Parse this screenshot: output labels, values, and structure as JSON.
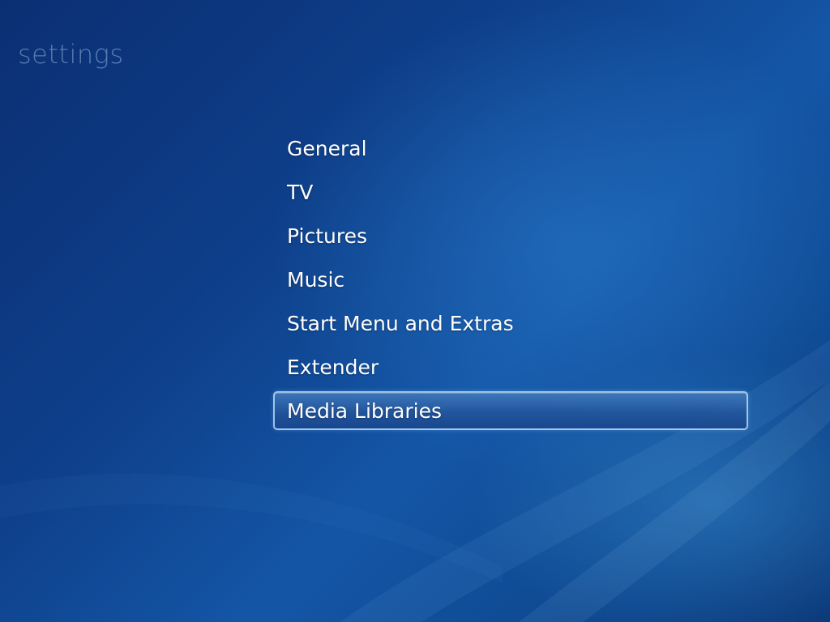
{
  "header": {
    "title": "settings"
  },
  "menu": {
    "items": [
      {
        "label": "General"
      },
      {
        "label": "TV"
      },
      {
        "label": "Pictures"
      },
      {
        "label": "Music"
      },
      {
        "label": "Start Menu and Extras"
      },
      {
        "label": "Extender"
      },
      {
        "label": "Media Libraries"
      }
    ],
    "selected": "Media Libraries"
  },
  "colors": {
    "background_dark": "#0b2f73",
    "background_light": "#1456a6",
    "text": "#ffffff",
    "title_text": "#96b9e1"
  }
}
